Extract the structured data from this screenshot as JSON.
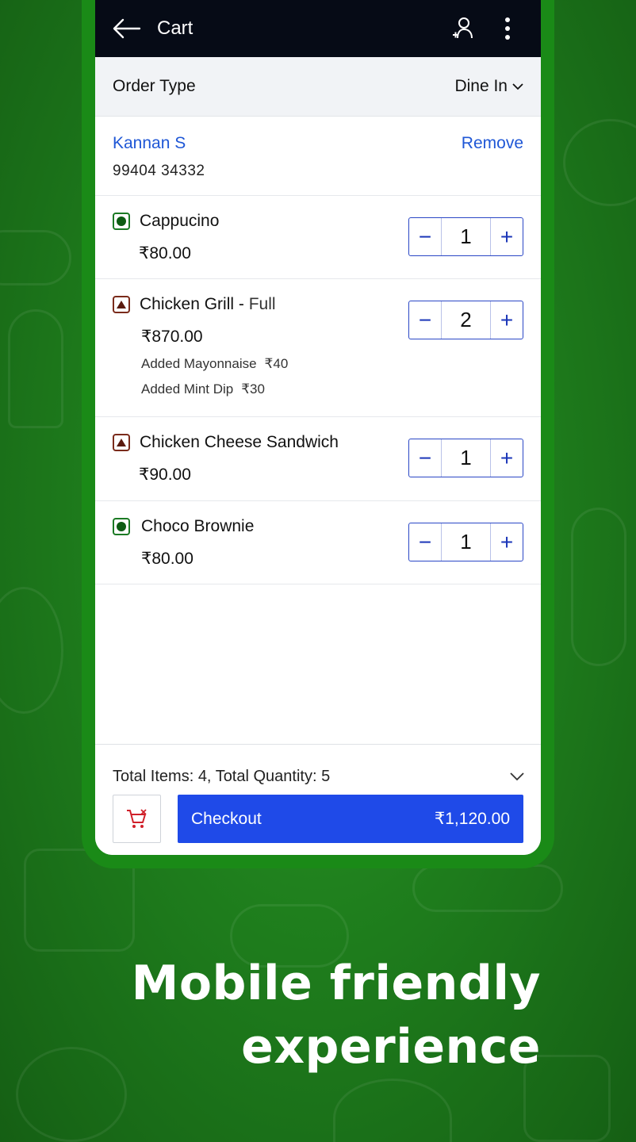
{
  "app_bar": {
    "title": "Cart",
    "back_icon": "arrow-left-icon",
    "user_icon": "add-user-icon",
    "menu_icon": "more-vertical-icon"
  },
  "order_type": {
    "label": "Order Type",
    "value": "Dine In"
  },
  "customer": {
    "name": "Kannan S",
    "phone": "99404 34332",
    "remove_label": "Remove"
  },
  "items": [
    {
      "name": "Cappucino",
      "variant": "",
      "type": "veg",
      "price": "₹80.00",
      "qty": "1",
      "addons": []
    },
    {
      "name": "Chicken Grill - ",
      "variant": "Full",
      "type": "non-veg",
      "price": "₹870.00",
      "qty": "2",
      "addons": [
        {
          "label": "Added Mayonnaise",
          "amount": "₹40"
        },
        {
          "label": "Added Mint Dip",
          "amount": "₹30"
        }
      ]
    },
    {
      "name": "Chicken Cheese Sandwich",
      "variant": "",
      "type": "non-veg",
      "price": "₹90.00",
      "qty": "1",
      "addons": []
    },
    {
      "name": "Choco Brownie",
      "variant": "",
      "type": "veg",
      "price": "₹80.00",
      "qty": "1",
      "addons": []
    }
  ],
  "footer": {
    "summary": "Total Items: 4, Total Quantity: 5",
    "checkout_label": "Checkout",
    "checkout_total": "₹1,120.00"
  },
  "tagline": {
    "line1": "Mobile friendly",
    "line2": "experience"
  },
  "colors": {
    "accent": "#1f4ae8",
    "link": "#1f57d6",
    "background": "#1f7f1d",
    "app_bar": "#060b16"
  }
}
